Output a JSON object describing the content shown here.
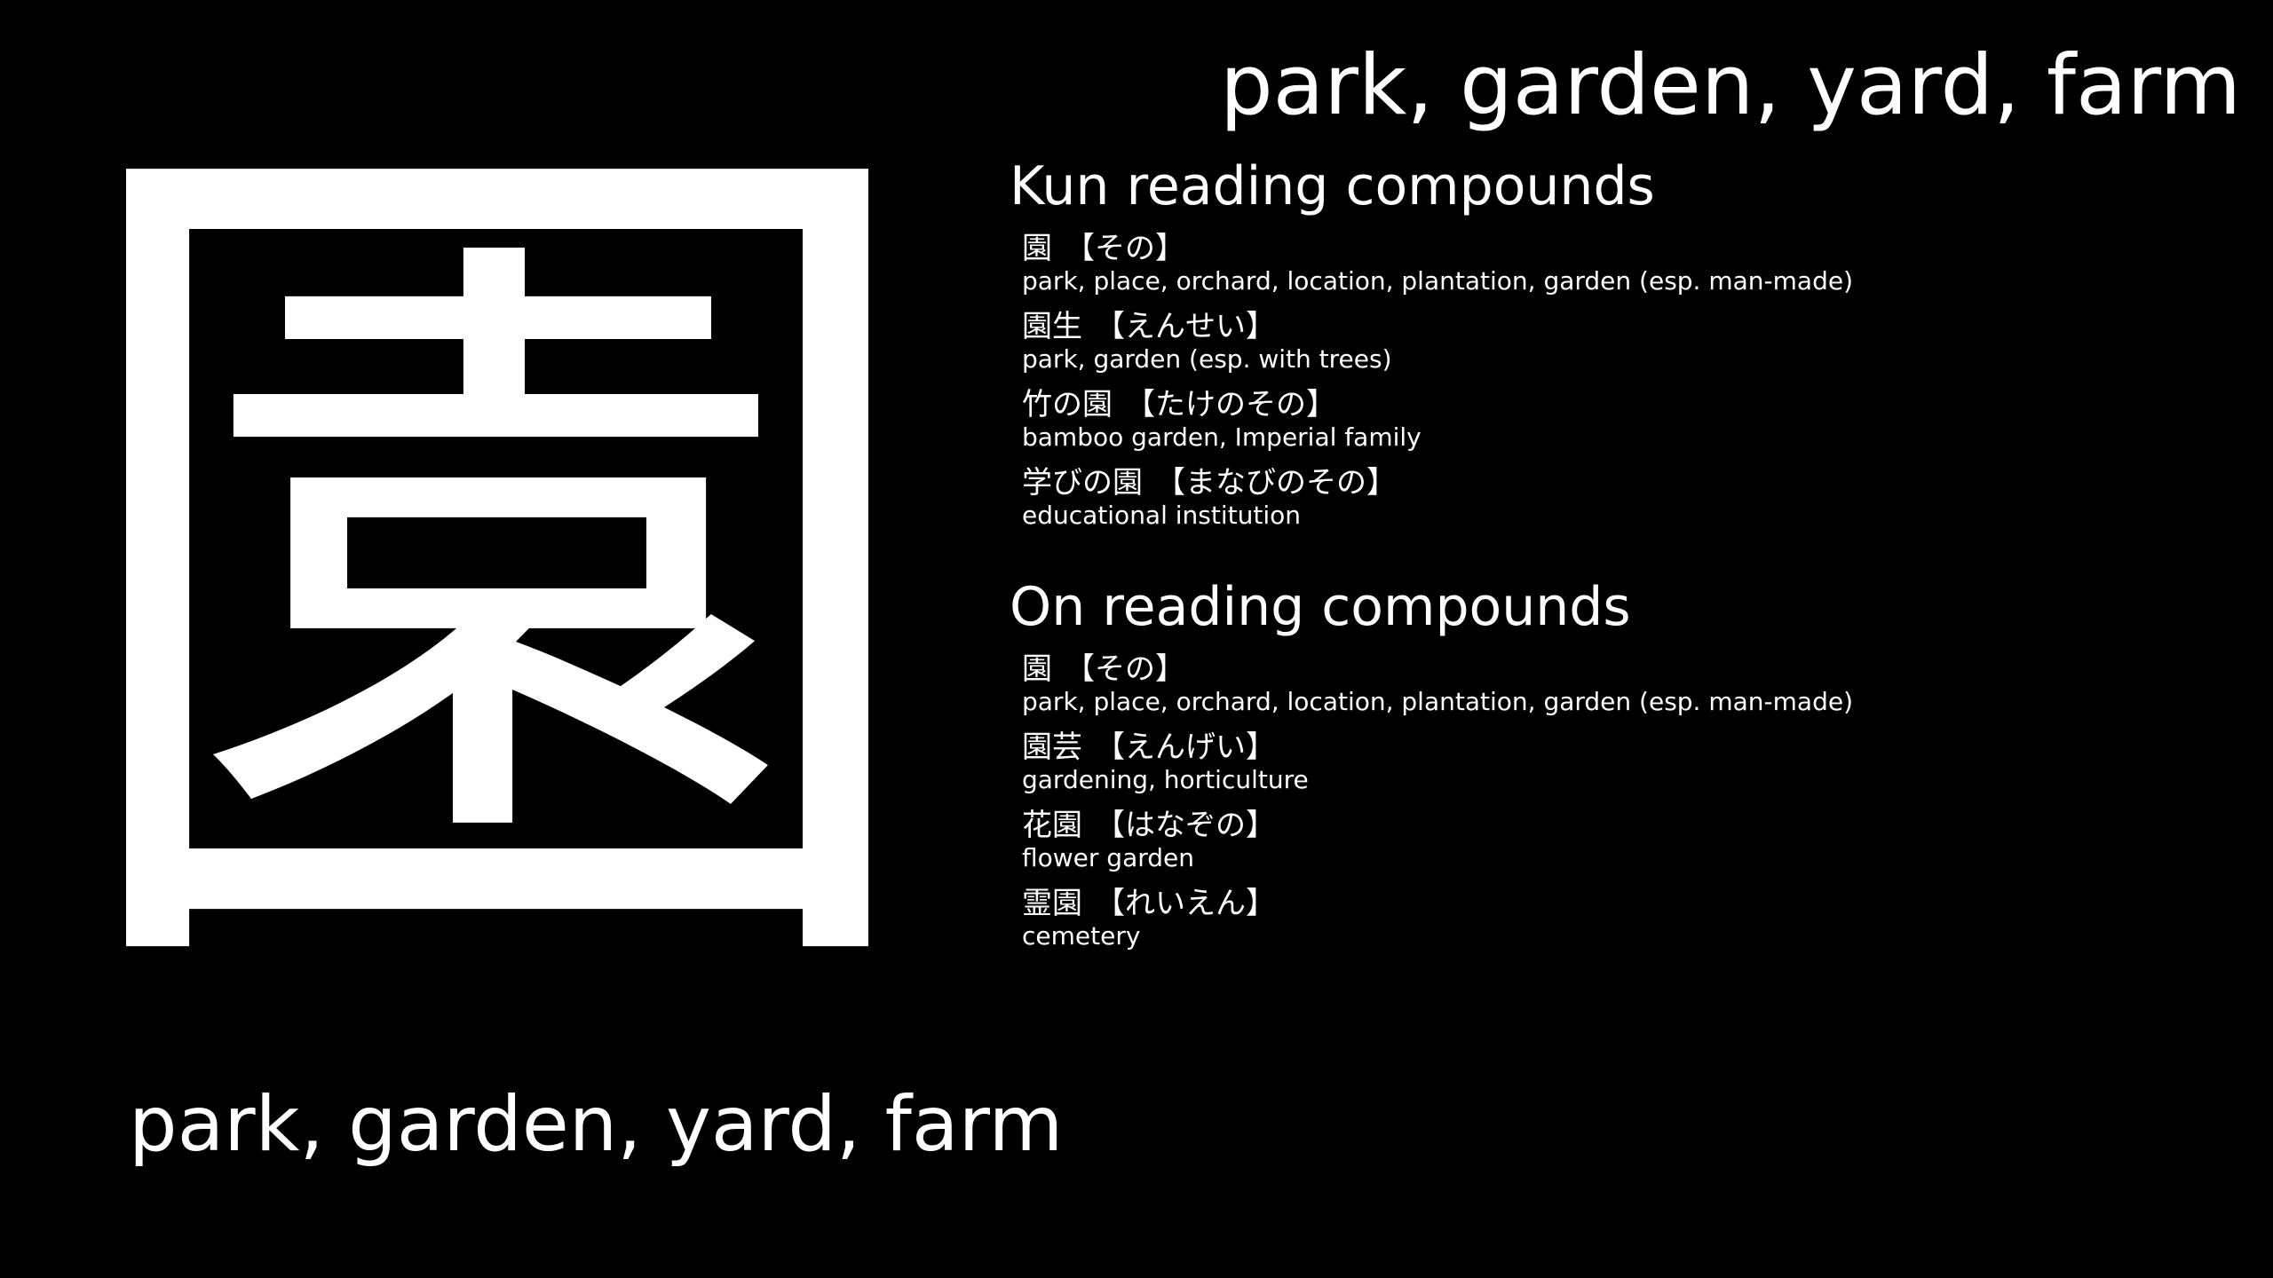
{
  "kanji": "園",
  "meaning_top": "park, garden, yard, farm",
  "meaning_bottom": "park, garden, yard, farm",
  "kun": {
    "title": "Kun reading compounds",
    "entries": [
      {
        "word": "園",
        "reading": "【その】",
        "gloss": "park, place, orchard, location, plantation, garden (esp. man-made)"
      },
      {
        "word": "園生",
        "reading": "【えんせい】",
        "gloss": "park, garden (esp. with trees)"
      },
      {
        "word": "竹の園",
        "reading": "【たけのその】",
        "gloss": "bamboo garden, Imperial family"
      },
      {
        "word": "学びの園",
        "reading": "【まなびのその】",
        "gloss": "educational institution"
      }
    ]
  },
  "on": {
    "title": "On reading compounds",
    "entries": [
      {
        "word": "園",
        "reading": "【その】",
        "gloss": "park, place, orchard, location, plantation, garden (esp. man-made)"
      },
      {
        "word": "園芸",
        "reading": "【えんげい】",
        "gloss": "gardening, horticulture"
      },
      {
        "word": "花園",
        "reading": "【はなぞの】",
        "gloss": "flower garden"
      },
      {
        "word": "霊園",
        "reading": "【れいえん】",
        "gloss": "cemetery"
      }
    ]
  }
}
